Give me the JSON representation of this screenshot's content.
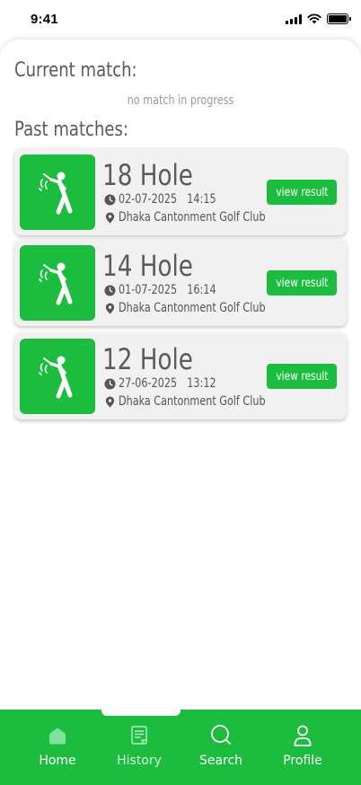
{
  "status_bar": {
    "time": "9:41"
  },
  "current_section": {
    "title": "Current match:",
    "empty_text": "no match in progress"
  },
  "past_section": {
    "title": "Past matches:",
    "matches": [
      {
        "title": "18 Hole",
        "date": "02-07-2025",
        "time": "14:15",
        "location": "Dhaka Cantonment Golf Club",
        "button_label": "view result"
      },
      {
        "title": "14 Hole",
        "date": "01-07-2025",
        "time": "16:14",
        "location": "Dhaka Cantonment Golf Club",
        "button_label": "view result"
      },
      {
        "title": "12 Hole",
        "date": "27-06-2025",
        "time": "13:12",
        "location": "Dhaka Cantonment Golf Club",
        "button_label": "view result"
      }
    ]
  },
  "bottom_nav": {
    "items": [
      {
        "label": "Home",
        "icon": "home-icon"
      },
      {
        "label": "History",
        "icon": "history-icon"
      },
      {
        "label": "Search",
        "icon": "search-icon"
      },
      {
        "label": "Profile",
        "icon": "profile-icon"
      }
    ]
  },
  "colors": {
    "accent": "#1cbd3f",
    "card_bg": "#f1f1f1",
    "text": "#5b5b5b"
  }
}
